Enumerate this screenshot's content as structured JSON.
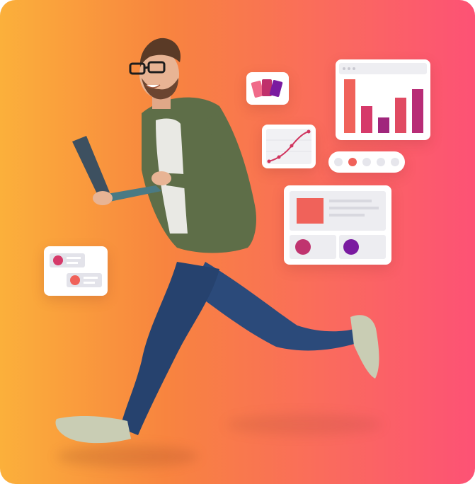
{
  "colors": {
    "gradient_start": "#fbb03b",
    "gradient_end": "#fd5275",
    "card_bg": "#ffffff",
    "bar_red": "#f0625a",
    "bar_pink": "#d63a6a",
    "bar_purple": "#a0267c",
    "circle_pink": "#c0346f",
    "circle_purple": "#7a1aa0",
    "swatch_coral": "#f0625a",
    "jeans": "#2b4a7a",
    "shirt": "#5e6e48",
    "laptop": "#3d5060",
    "skin": "#e8b494",
    "shoe": "#c9cdb4"
  },
  "icons": {
    "palette": "color-palette-icon",
    "line_chart": "line-chart-icon",
    "bar_chart": "bar-chart-icon",
    "carousel": "carousel-dots-icon",
    "layout": "layout-wireframe-icon",
    "list": "list-wireframe-icon",
    "person": "jumping-man-with-laptop"
  }
}
